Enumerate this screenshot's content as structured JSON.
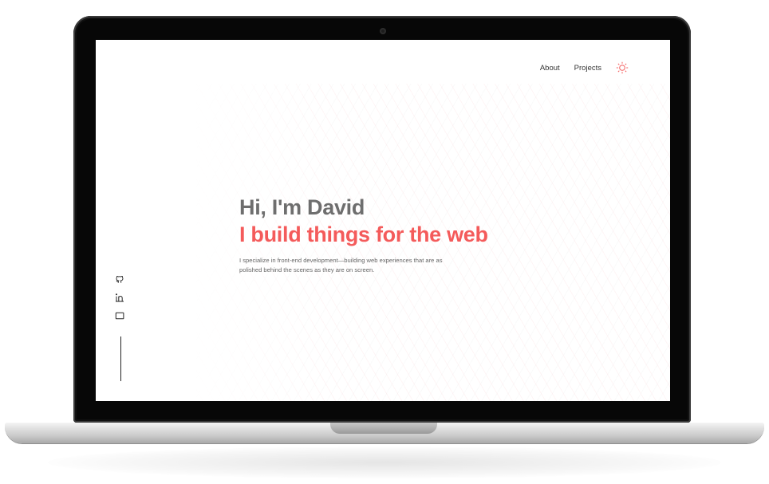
{
  "nav": {
    "items": [
      {
        "label": "About"
      },
      {
        "label": "Projects"
      }
    ],
    "theme_icon": "sun-icon"
  },
  "hero": {
    "greeting": "Hi, I'm David",
    "tagline": "I build things for the web",
    "description": "I specialize in front-end development—building web experiences that are as polished behind the scenes as they are on screen."
  },
  "social": {
    "icons": [
      "github-icon",
      "linkedin-icon",
      "message-icon"
    ]
  },
  "colors": {
    "accent": "#f45b5b",
    "heading": "#6e6e6e",
    "text": "#666666",
    "bezel": "#070707"
  }
}
